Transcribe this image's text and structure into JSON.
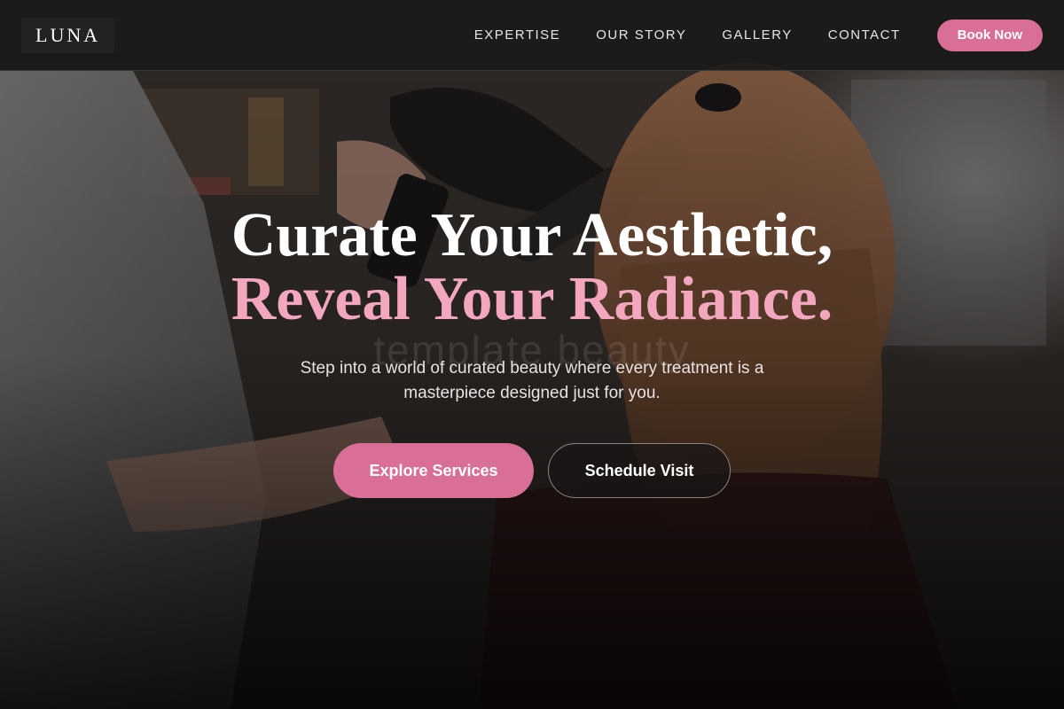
{
  "brand": {
    "logo_text": "LUNA"
  },
  "nav": {
    "items": [
      {
        "label": "EXPERTISE"
      },
      {
        "label": "OUR STORY"
      },
      {
        "label": "GALLERY"
      },
      {
        "label": "CONTACT"
      }
    ],
    "book_label": "Book Now"
  },
  "hero": {
    "headline_line1": "Curate Your Aesthetic,",
    "headline_line2": "Reveal Your Radiance.",
    "watermark": "template beauty",
    "subtitle": "Step into a world of curated beauty where every treatment is a masterpiece designed just for you.",
    "primary_cta": "Explore Services",
    "secondary_cta": "Schedule Visit"
  },
  "colors": {
    "accent": "#d96e96",
    "headline_pink": "#f2a7bf",
    "header_bg": "#1a1a1a"
  }
}
